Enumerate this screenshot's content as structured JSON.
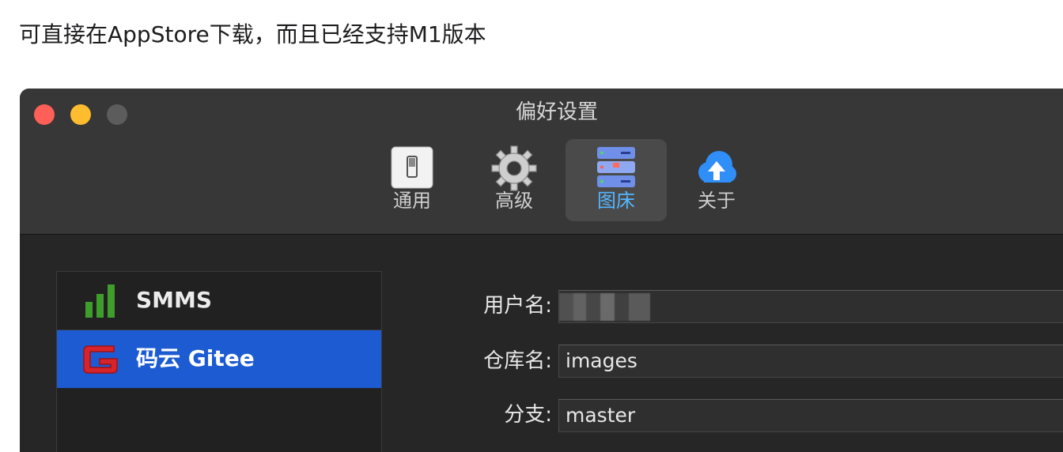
{
  "caption": "可直接在AppStore下载，而且已经支持M1版本",
  "window": {
    "title": "偏好设置"
  },
  "tabs": [
    {
      "label": "通用",
      "icon": "switch-icon",
      "active": false
    },
    {
      "label": "高级",
      "icon": "gear-icon",
      "active": false
    },
    {
      "label": "图床",
      "icon": "server-icon",
      "active": true
    },
    {
      "label": "关于",
      "icon": "cloud-upload-icon",
      "active": false
    }
  ],
  "sidebar": {
    "items": [
      {
        "label": "SMMS",
        "icon": "signal-bars-icon",
        "selected": false
      },
      {
        "label": "码云 Gitee",
        "icon": "gitee-logo-icon",
        "selected": true
      }
    ]
  },
  "form": {
    "username_label": "用户名:",
    "username_value": "",
    "repo_label": "仓库名:",
    "repo_value": "images",
    "branch_label": "分支:",
    "branch_value": "master"
  },
  "colors": {
    "selected_row": "#1d5bd2",
    "active_tab_text": "#55b6ff",
    "close": "#fe5f57",
    "minimize": "#febc2e"
  }
}
